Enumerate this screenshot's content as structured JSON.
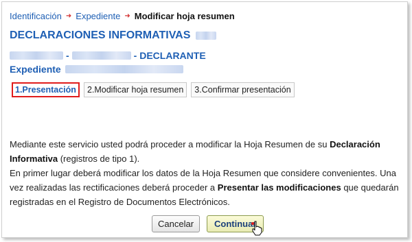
{
  "breadcrumb": {
    "items": [
      "Identificación",
      "Expediente"
    ],
    "current": "Modificar hoja resumen"
  },
  "header": {
    "title": "DECLARACIONES INFORMATIVAS",
    "dash1": "-",
    "dash2": "- DECLARANTE",
    "expediente_label": "Expediente"
  },
  "tabs": [
    {
      "label": "1.Presentación",
      "active": true
    },
    {
      "label": "2.Modificar hoja resumen",
      "active": false
    },
    {
      "label": "3.Confirmar presentación",
      "active": false
    }
  ],
  "description": {
    "p1_a": "Mediante este servicio usted podrá proceder a modificar la Hoja Resumen de su ",
    "p1_b": "Declaración Informativa",
    "p1_c": " (registros de tipo 1).",
    "p2_a": "En primer lugar deberá modificar los datos de la Hoja Resumen que considere convenientes. Una vez realizadas las rectificaciones deberá proceder a ",
    "p2_b": "Presentar las modificaciones",
    "p2_c": " que quedarán registradas en el Registro de Documentos Electrónicos."
  },
  "buttons": {
    "cancel": "Cancelar",
    "continue": "Continuar"
  },
  "colors": {
    "link": "#1e5fb4",
    "active_tab_border": "#e01c1c",
    "breadcrumb_separator": "#d23030"
  }
}
